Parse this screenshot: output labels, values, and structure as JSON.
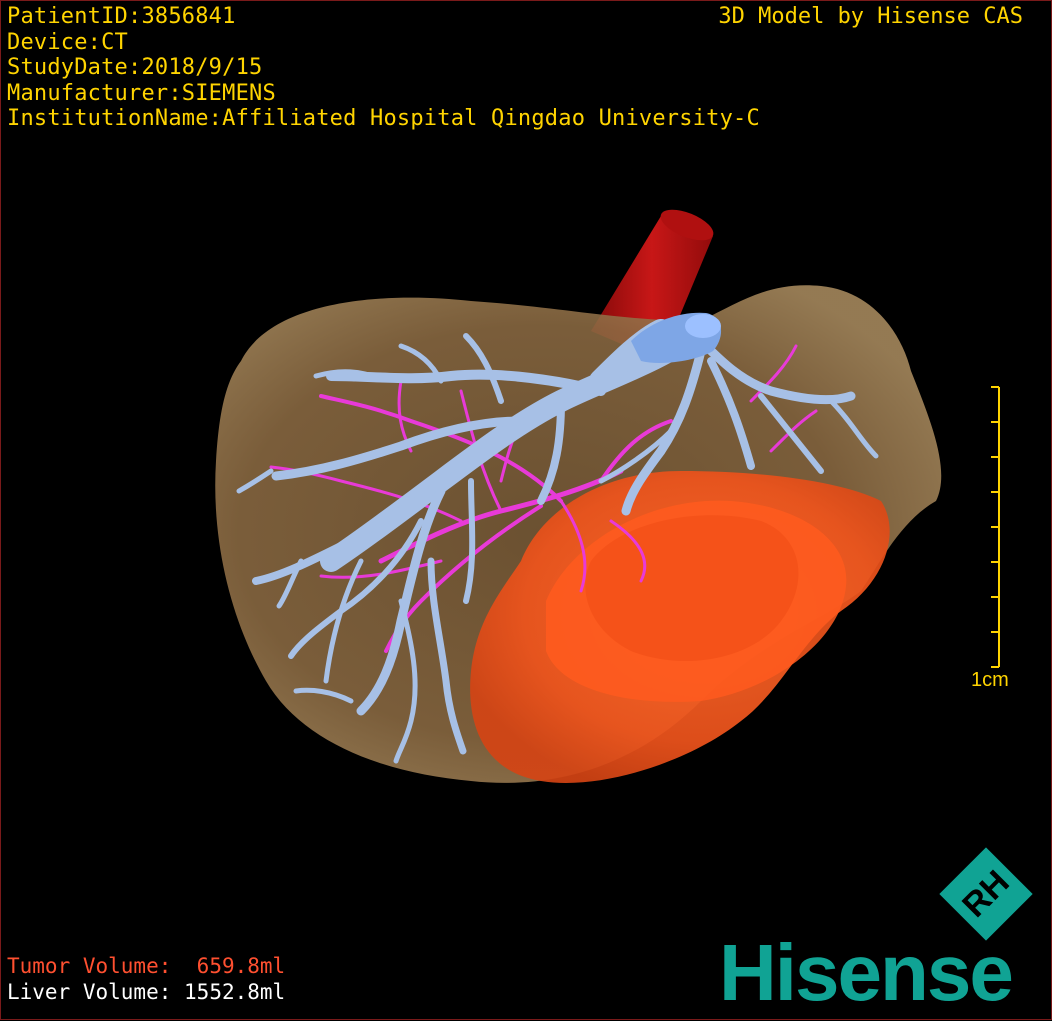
{
  "overlay": {
    "patient_id": "PatientID:3856841",
    "device": "Device:CT",
    "study_date": "StudyDate:2018/9/15",
    "manufacturer": "Manufacturer:SIEMENS",
    "institution": "InstitutionName:Affiliated Hospital Qingdao University-C",
    "credit": "3D Model by Hisense CAS"
  },
  "scale": {
    "label": "1cm"
  },
  "volumes": {
    "tumor_label": "Tumor Volume:",
    "tumor_value": "659.8ml",
    "liver_label": "Liver Volume:",
    "liver_value": "1552.8ml"
  },
  "brand": {
    "name": "Hisense",
    "mark_letters": "RH",
    "color": "#10a394"
  },
  "colors": {
    "text_info": "#ffd400",
    "tumor_text": "#ff5030",
    "liver": "#8a6a3e",
    "tumor": "#ff5a1e",
    "portal_vein": "#a7c0e6",
    "hepatic_artery": "#e83ad8",
    "vena_cava": "#c81414"
  }
}
